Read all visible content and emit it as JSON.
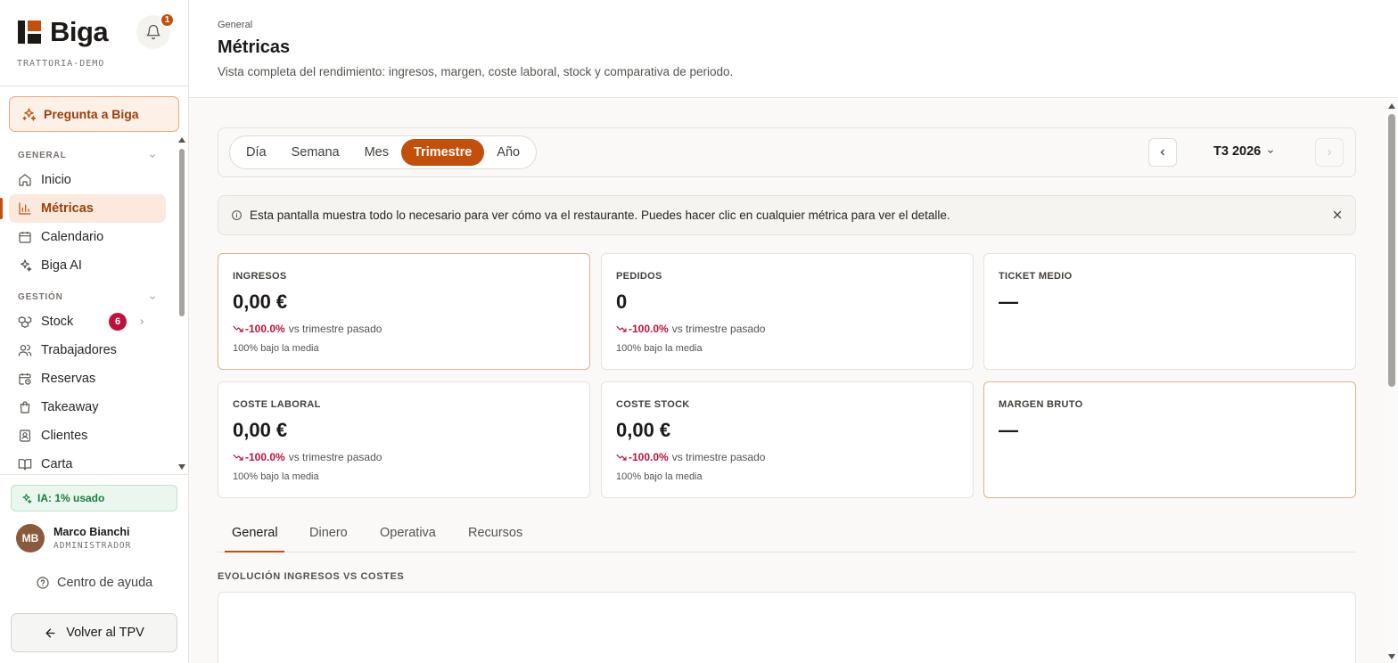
{
  "sidebar": {
    "brand": "Biga",
    "tenant": "TRATTORIA-DEMO",
    "notifications_count": "1",
    "ask_label": "Pregunta a Biga",
    "sections": [
      {
        "title": "GENERAL"
      },
      {
        "title": "GESTIÓN"
      }
    ],
    "items": [
      {
        "label": "Inicio",
        "icon": "home-icon"
      },
      {
        "label": "Métricas",
        "icon": "bar-chart-icon",
        "active": true
      },
      {
        "label": "Calendario",
        "icon": "calendar-icon"
      },
      {
        "label": "Biga AI",
        "icon": "sparkles-icon"
      },
      {
        "label": "Stock",
        "icon": "boxes-icon",
        "badge": "6"
      },
      {
        "label": "Trabajadores",
        "icon": "users-icon"
      },
      {
        "label": "Reservas",
        "icon": "calendar-clock-icon"
      },
      {
        "label": "Takeaway",
        "icon": "shopping-bag-icon"
      },
      {
        "label": "Clientes",
        "icon": "contact-icon"
      },
      {
        "label": "Carta",
        "icon": "book-icon"
      }
    ],
    "usage_label": "IA: 1% usado",
    "user": {
      "initials": "MB",
      "name": "Marco Bianchi",
      "role": "ADMINISTRADOR"
    },
    "help_label": "Centro de ayuda",
    "back_label": "Volver al TPV"
  },
  "header": {
    "breadcrumb": "General",
    "title": "Métricas",
    "subtitle": "Vista completa del rendimiento: ingresos, margen, coste laboral, stock y comparativa de periodo."
  },
  "period": {
    "options": [
      "Día",
      "Semana",
      "Mes",
      "Trimestre",
      "Año"
    ],
    "selected": "Trimestre",
    "current": "T3 2026"
  },
  "info_banner": "Esta pantalla muestra todo lo necesario para ver cómo va el restaurante. Puedes hacer clic en cualquier métrica para ver el detalle.",
  "metrics": [
    {
      "label": "INGRESOS",
      "value": "0,00 €",
      "delta": "-100.0%",
      "delta_suffix": "vs trimestre pasado",
      "note": "100% bajo la media"
    },
    {
      "label": "PEDIDOS",
      "value": "0",
      "delta": "-100.0%",
      "delta_suffix": "vs trimestre pasado",
      "note": "100% bajo la media"
    },
    {
      "label": "TICKET MEDIO",
      "value": "—"
    },
    {
      "label": "COSTE LABORAL",
      "value": "0,00 €",
      "delta": "-100.0%",
      "delta_suffix": "vs trimestre pasado",
      "note": "100% bajo la media"
    },
    {
      "label": "COSTE STOCK",
      "value": "0,00 €",
      "delta": "-100.0%",
      "delta_suffix": "vs trimestre pasado",
      "note": "100% bajo la media"
    },
    {
      "label": "MARGEN BRUTO",
      "value": "—"
    }
  ],
  "tabs": [
    "General",
    "Dinero",
    "Operativa",
    "Recursos"
  ],
  "active_tab": "General",
  "section_title": "EVOLUCIÓN INGRESOS VS COSTES",
  "colors": {
    "accent": "#c2500a",
    "negative": "#be123c",
    "positive": "#16803c"
  }
}
